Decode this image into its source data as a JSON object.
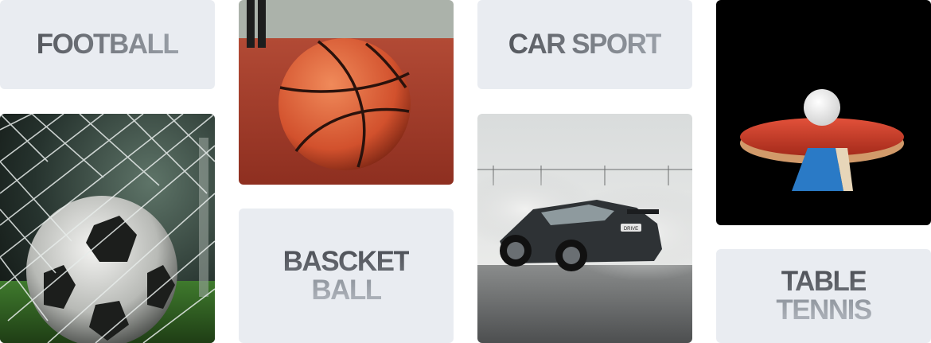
{
  "cards": {
    "football_label": "FOOTBALL",
    "basketball_label_line1": "BASCKET",
    "basketball_label_line2": "BALL",
    "car_sport_label": "CAR SPORT",
    "table_tennis_label_line1": "TABLE",
    "table_tennis_label_line2": "TENNIS",
    "car_plate_text": "DRIVE"
  },
  "colors": {
    "label_card_bg": "#e9ecf1",
    "label_text_dark": "#55585e",
    "label_text_light": "#9aa0a8"
  },
  "icons": {
    "football_image": "soccer-ball-in-net",
    "basketball_image": "basketball-on-court",
    "car_image": "drifting-car-smoke",
    "table_tennis_image": "ping-pong-paddle-and-ball"
  }
}
